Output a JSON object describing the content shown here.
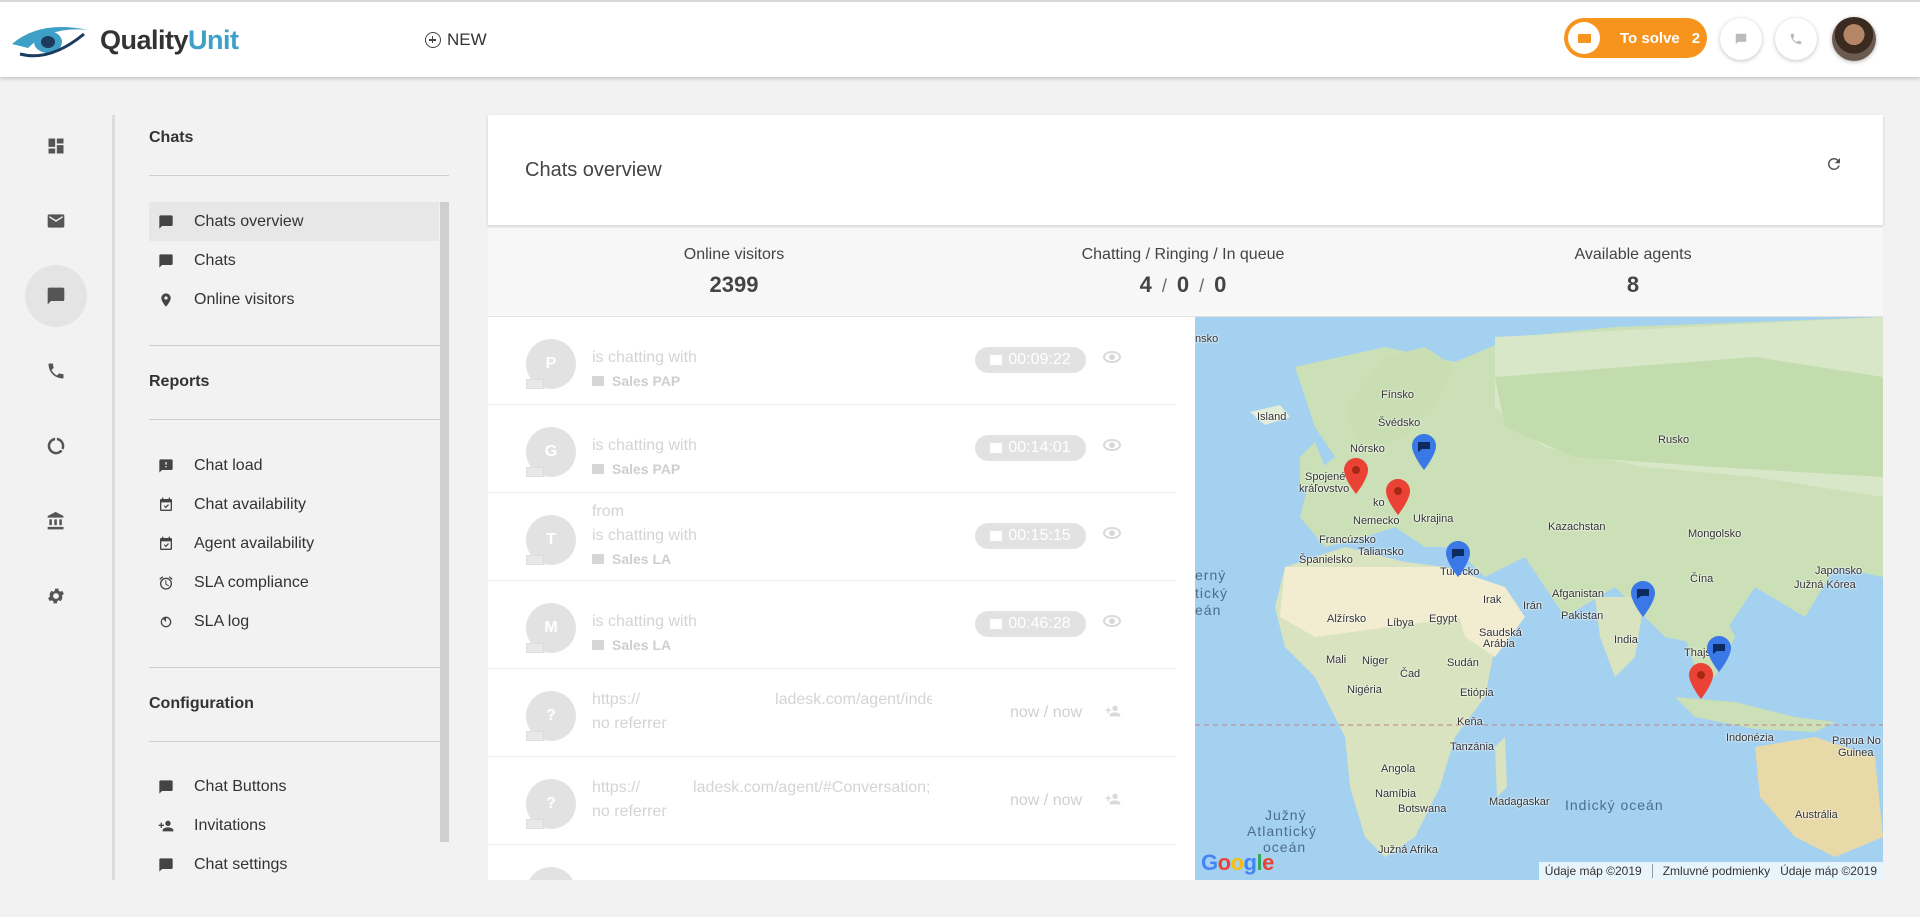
{
  "header": {
    "logo": {
      "quality": "Quality",
      "unit": "Unit"
    },
    "new_label": "NEW",
    "to_solve": {
      "label": "To solve",
      "count": "2"
    }
  },
  "rail": {
    "items": [
      {
        "name": "dashboard-icon"
      },
      {
        "name": "mail-icon"
      },
      {
        "name": "chat-icon",
        "active": true
      },
      {
        "name": "phone-icon"
      },
      {
        "name": "reports-icon"
      },
      {
        "name": "bank-icon"
      },
      {
        "name": "gear-icon"
      }
    ]
  },
  "sidebar": {
    "chats_heading": "Chats",
    "chats_items": [
      "Chats overview",
      "Chats",
      "Online visitors"
    ],
    "reports_heading": "Reports",
    "reports_items": [
      "Chat load",
      "Chat availability",
      "Agent availability",
      "SLA compliance",
      "SLA log"
    ],
    "config_heading": "Configuration",
    "config_items": [
      "Chat Buttons",
      "Invitations",
      "Chat settings"
    ]
  },
  "main": {
    "title": "Chats overview",
    "stats": {
      "online_label": "Online visitors",
      "online_value": "2399",
      "chatting_label": "Chatting / Ringing / In queue",
      "chatting": "4",
      "ringing": "0",
      "queue": "0",
      "slash": "/",
      "agents_label": "Available agents",
      "agents_value": "8"
    },
    "rows": [
      {
        "initial": "P",
        "line1": "is chatting with",
        "dept": "Sales PAP",
        "time": "00:09:22"
      },
      {
        "initial": "G",
        "line1": "is chatting with",
        "dept": "Sales PAP",
        "time": "00:14:01"
      },
      {
        "initial": "T",
        "line0": "from",
        "line1": "is chatting with",
        "dept": "Sales LA",
        "time": "00:15:15"
      },
      {
        "initial": "M",
        "line1": "is chatting with",
        "dept": "Sales LA",
        "time": "00:46:28"
      },
      {
        "initial": "?",
        "url_a": "https://",
        "url_b": "ladesk.com/agent/inde",
        "ref": "no referrer",
        "when": "now / now"
      },
      {
        "initial": "?",
        "url_a": "https://",
        "url_b": "ladesk.com/agent/#Conversation;",
        "ref": "no referrer",
        "when": "now / now"
      }
    ]
  },
  "map": {
    "labels": [
      {
        "text": "nsko"
      },
      {
        "text": "Island"
      },
      {
        "text": "Fínsko"
      },
      {
        "text": "Švédsko"
      },
      {
        "text": "Nórsko"
      },
      {
        "text": "Rusko"
      },
      {
        "text": "Spojené"
      },
      {
        "text": "kráľovstvo"
      },
      {
        "text": "ko"
      },
      {
        "text": "Nemecko"
      },
      {
        "text": "Ukrajina"
      },
      {
        "text": "Kazachstan"
      },
      {
        "text": "Mongolsko"
      },
      {
        "text": "Francúzsko"
      },
      {
        "text": "Taliansko"
      },
      {
        "text": "Španielsko"
      },
      {
        "text": "Turecko"
      },
      {
        "text": "Čína"
      },
      {
        "text": "Japonsko"
      },
      {
        "text": "Južná Kórea"
      },
      {
        "text": "Afganistan"
      },
      {
        "text": "Irak"
      },
      {
        "text": "Irán"
      },
      {
        "text": "Pakistan"
      },
      {
        "text": "Alžírsko"
      },
      {
        "text": "Líbya"
      },
      {
        "text": "Egypt"
      },
      {
        "text": "Saudská"
      },
      {
        "text": "Arábia"
      },
      {
        "text": "India"
      },
      {
        "text": "Thajs"
      },
      {
        "text": "Mali"
      },
      {
        "text": "Niger"
      },
      {
        "text": "Čad"
      },
      {
        "text": "Sudán"
      },
      {
        "text": "Nigéria"
      },
      {
        "text": "Etiópia"
      },
      {
        "text": "Keňa"
      },
      {
        "text": "Tanzánia"
      },
      {
        "text": "Indonézia"
      },
      {
        "text": "Papua No"
      },
      {
        "text": "Guinea"
      },
      {
        "text": "Angola"
      },
      {
        "text": "Namíbia"
      },
      {
        "text": "Botswana"
      },
      {
        "text": "Madagaskar"
      },
      {
        "text": "Austrália"
      },
      {
        "text": "Južná Afrika"
      }
    ],
    "oceans": [
      "erný",
      "tický",
      "eán",
      "Indický oceán",
      "Južný",
      "Atlantický",
      "oceán"
    ],
    "attribution": "Údaje máp ©2019",
    "terms": "Zmluvné podmienky",
    "attribution2": "Údaje máp ©2019"
  }
}
